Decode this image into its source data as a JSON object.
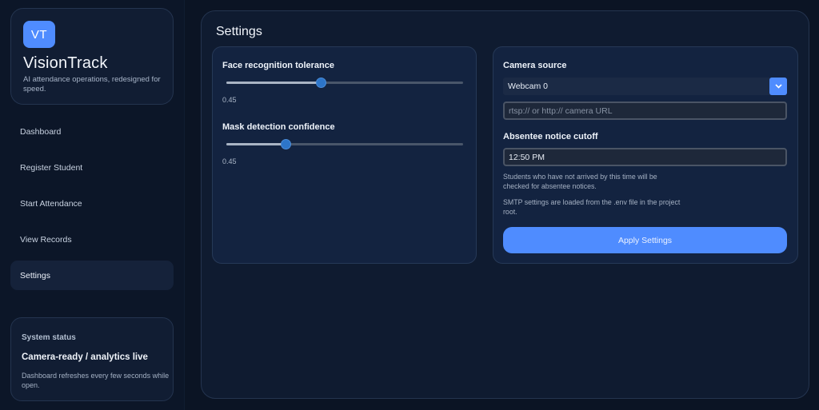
{
  "brand": {
    "logo_initials": "VT",
    "name": "VisionTrack",
    "tagline": "AI attendance operations, redesigned for speed."
  },
  "nav": {
    "items": [
      {
        "label": "Dashboard",
        "active": false
      },
      {
        "label": "Register Student",
        "active": false
      },
      {
        "label": "Start Attendance",
        "active": false
      },
      {
        "label": "View Records",
        "active": false
      },
      {
        "label": "Settings",
        "active": true
      }
    ]
  },
  "system_status": {
    "label": "System status",
    "title": "Camera-ready / analytics live",
    "note": "Dashboard refreshes every few seconds while open."
  },
  "page": {
    "title": "Settings"
  },
  "settings": {
    "face_tolerance": {
      "label": "Face recognition tolerance",
      "value_text": "0.45",
      "fraction": 0.4
    },
    "mask_confidence": {
      "label": "Mask detection confidence",
      "value_text": "0.45",
      "fraction": 0.25
    },
    "camera_source": {
      "label": "Camera source",
      "selected": "Webcam 0",
      "url_placeholder": "rtsp:// or http:// camera URL",
      "dropdown_icon": "chevron-down-icon"
    },
    "absentee_cutoff": {
      "label": "Absentee notice cutoff",
      "value": "12:50 PM",
      "help_1": "Students who have not arrived by this time will be checked for absentee notices.",
      "help_2": "SMTP settings are loaded from the .env file in the project root."
    },
    "apply_label": "Apply Settings"
  },
  "colors": {
    "accent": "#4f8cff",
    "background": "#0b1424",
    "card": "#132340",
    "slider_thumb": "#2d75c9"
  }
}
